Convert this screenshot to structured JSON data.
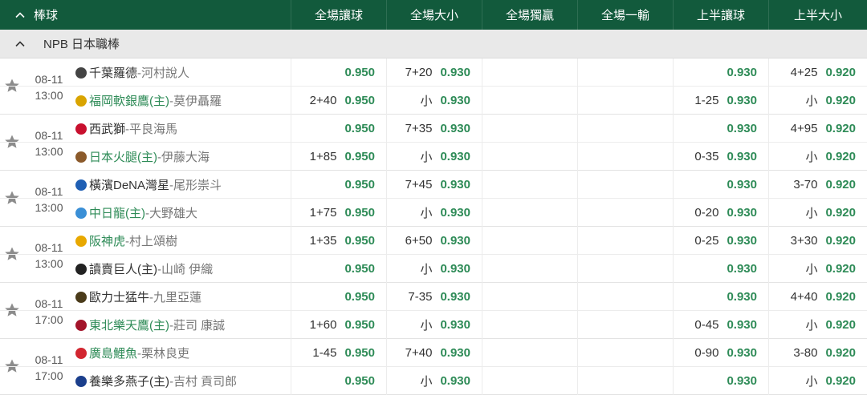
{
  "header": {
    "sport": "棒球",
    "columns": [
      "全場讓球",
      "全場大小",
      "全場獨贏",
      "全場一輸",
      "上半讓球",
      "上半大小"
    ]
  },
  "league": {
    "name": "NPB 日本職棒"
  },
  "colors": {
    "header_bg": "#125a3c",
    "odds": "#2e8b57",
    "home_team": "#2e8b57"
  },
  "matches": [
    {
      "date": "08-11",
      "time": "13:00",
      "away": {
        "name": "千葉羅德",
        "pitcher": " -河村說人",
        "home": false,
        "logo_color": "#444"
      },
      "home": {
        "name": "福岡軟銀鷹(主)",
        "pitcher": " -莫伊聶羅",
        "home": true,
        "logo_color": "#d9a400"
      },
      "rows": [
        [
          {
            "line": "",
            "odds": "0.950"
          },
          {
            "line": "7+20",
            "odds": "0.930"
          },
          null,
          null,
          {
            "line": "",
            "odds": "0.930"
          },
          {
            "line": "4+25",
            "odds": "0.920"
          }
        ],
        [
          {
            "line": "2+40",
            "odds": "0.950"
          },
          {
            "line": "小",
            "odds": "0.930"
          },
          null,
          null,
          {
            "line": "1-25",
            "odds": "0.930"
          },
          {
            "line": "小",
            "odds": "0.920"
          }
        ]
      ]
    },
    {
      "date": "08-11",
      "time": "13:00",
      "away": {
        "name": "西武獅",
        "pitcher": " -平良海馬",
        "home": false,
        "logo_color": "#c8102e"
      },
      "home": {
        "name": "日本火腿(主)",
        "pitcher": " -伊藤大海",
        "home": true,
        "logo_color": "#8b5a2b"
      },
      "rows": [
        [
          {
            "line": "",
            "odds": "0.950"
          },
          {
            "line": "7+35",
            "odds": "0.930"
          },
          null,
          null,
          {
            "line": "",
            "odds": "0.930"
          },
          {
            "line": "4+95",
            "odds": "0.920"
          }
        ],
        [
          {
            "line": "1+85",
            "odds": "0.950"
          },
          {
            "line": "小",
            "odds": "0.930"
          },
          null,
          null,
          {
            "line": "0-35",
            "odds": "0.930"
          },
          {
            "line": "小",
            "odds": "0.920"
          }
        ]
      ]
    },
    {
      "date": "08-11",
      "time": "13:00",
      "away": {
        "name": "橫濱DeNA灣星",
        "pitcher": " -尾形崇斗",
        "home": false,
        "logo_color": "#1f5fb4"
      },
      "home": {
        "name": "中日龍(主)",
        "pitcher": " -大野雄大",
        "home": true,
        "logo_color": "#3a8fd6"
      },
      "rows": [
        [
          {
            "line": "",
            "odds": "0.950"
          },
          {
            "line": "7+45",
            "odds": "0.930"
          },
          null,
          null,
          {
            "line": "",
            "odds": "0.930"
          },
          {
            "line": "3-70",
            "odds": "0.920"
          }
        ],
        [
          {
            "line": "1+75",
            "odds": "0.950"
          },
          {
            "line": "小",
            "odds": "0.930"
          },
          null,
          null,
          {
            "line": "0-20",
            "odds": "0.930"
          },
          {
            "line": "小",
            "odds": "0.920"
          }
        ]
      ]
    },
    {
      "date": "08-11",
      "time": "13:00",
      "away": {
        "name": "阪神虎",
        "pitcher": " -村上頌樹",
        "home": true,
        "logo_color": "#e8a800"
      },
      "home": {
        "name": "讀賣巨人(主)",
        "pitcher": " -山崎 伊織",
        "home": false,
        "logo_color": "#222"
      },
      "rows": [
        [
          {
            "line": "1+35",
            "odds": "0.950"
          },
          {
            "line": "6+50",
            "odds": "0.930"
          },
          null,
          null,
          {
            "line": "0-25",
            "odds": "0.930"
          },
          {
            "line": "3+30",
            "odds": "0.920"
          }
        ],
        [
          {
            "line": "",
            "odds": "0.950"
          },
          {
            "line": "小",
            "odds": "0.930"
          },
          null,
          null,
          {
            "line": "",
            "odds": "0.930"
          },
          {
            "line": "小",
            "odds": "0.920"
          }
        ]
      ]
    },
    {
      "date": "08-11",
      "time": "17:00",
      "away": {
        "name": "歐力士猛牛",
        "pitcher": " -九里亞蓮",
        "home": false,
        "logo_color": "#4a3b1a"
      },
      "home": {
        "name": "東北樂天鷹(主)",
        "pitcher": " -莊司 康誠",
        "home": true,
        "logo_color": "#a3142a"
      },
      "rows": [
        [
          {
            "line": "",
            "odds": "0.950"
          },
          {
            "line": "7-35",
            "odds": "0.930"
          },
          null,
          null,
          {
            "line": "",
            "odds": "0.930"
          },
          {
            "line": "4+40",
            "odds": "0.920"
          }
        ],
        [
          {
            "line": "1+60",
            "odds": "0.950"
          },
          {
            "line": "小",
            "odds": "0.930"
          },
          null,
          null,
          {
            "line": "0-45",
            "odds": "0.930"
          },
          {
            "line": "小",
            "odds": "0.920"
          }
        ]
      ]
    },
    {
      "date": "08-11",
      "time": "17:00",
      "away": {
        "name": "廣島鯉魚",
        "pitcher": " -栗林良吏",
        "home": true,
        "logo_color": "#d22630"
      },
      "home": {
        "name": "養樂多燕子(主)",
        "pitcher": " -吉村 貢司郎",
        "home": false,
        "logo_color": "#1b3f8c"
      },
      "rows": [
        [
          {
            "line": "1-45",
            "odds": "0.950"
          },
          {
            "line": "7+40",
            "odds": "0.930"
          },
          null,
          null,
          {
            "line": "0-90",
            "odds": "0.930"
          },
          {
            "line": "3-80",
            "odds": "0.920"
          }
        ],
        [
          {
            "line": "",
            "odds": "0.950"
          },
          {
            "line": "小",
            "odds": "0.930"
          },
          null,
          null,
          {
            "line": "",
            "odds": "0.930"
          },
          {
            "line": "小",
            "odds": "0.920"
          }
        ]
      ]
    }
  ]
}
